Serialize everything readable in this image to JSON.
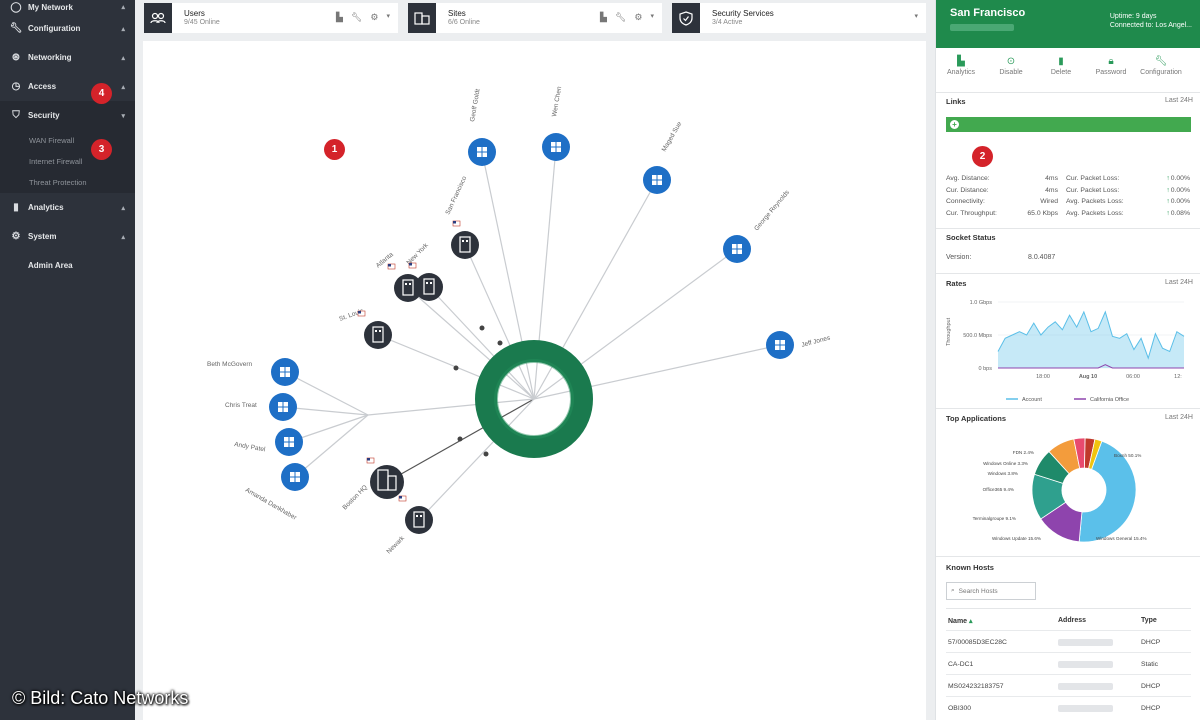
{
  "sidebar": {
    "items": [
      {
        "label": "My Network",
        "icon": "circle-icon"
      },
      {
        "label": "Configuration",
        "icon": "wrench-icon"
      },
      {
        "label": "Networking",
        "icon": "network-icon"
      },
      {
        "label": "Access",
        "icon": "clock-icon"
      },
      {
        "label": "Security",
        "icon": "shield-icon"
      }
    ],
    "security_sub": [
      "WAN Firewall",
      "Internet Firewall",
      "Threat Protection"
    ],
    "items2": [
      {
        "label": "Analytics",
        "icon": "bar-chart-icon"
      },
      {
        "label": "System",
        "icon": "gear-icon"
      }
    ],
    "admin": "Admin Area"
  },
  "badges": {
    "b1": "1",
    "b2": "2",
    "b3": "3",
    "b4": "4"
  },
  "topcards": [
    {
      "title": "Users",
      "sub": "9/45 Online",
      "icon": "users-icon"
    },
    {
      "title": "Sites",
      "sub": "6/6 Online",
      "icon": "buildings-icon"
    },
    {
      "title": "Security Services",
      "sub": "3/4 Active",
      "icon": "shield-icon"
    }
  ],
  "topology": {
    "hub": "san-francisco-hub",
    "nodes": [
      {
        "label": "Geoff Goldt",
        "kind": "windows"
      },
      {
        "label": "Wen Chen",
        "kind": "windows"
      },
      {
        "label": "Maged Sue",
        "kind": "windows"
      },
      {
        "label": "George Reynolds",
        "kind": "windows"
      },
      {
        "label": "Jeff Jones",
        "kind": "windows"
      },
      {
        "label": "San Francisco",
        "kind": "site"
      },
      {
        "label": "New York",
        "kind": "site"
      },
      {
        "label": "Atlanta",
        "kind": "site"
      },
      {
        "label": "St. Louis",
        "kind": "site"
      },
      {
        "label": "Beth McGovern",
        "kind": "windows"
      },
      {
        "label": "Chris Treat",
        "kind": "windows"
      },
      {
        "label": "Andy Patel",
        "kind": "windows"
      },
      {
        "label": "Amanda Dankhaber",
        "kind": "windows"
      },
      {
        "label": "Boston HQ",
        "kind": "hq"
      },
      {
        "label": "Newark",
        "kind": "site"
      }
    ]
  },
  "panel": {
    "title": "San Francisco",
    "uptime": "Uptime: 9 days",
    "connected": "Connected to: Los Angel...",
    "actions": [
      {
        "label": "Analytics",
        "icon": "analytics-icon"
      },
      {
        "label": "Disable",
        "icon": "disable-icon"
      },
      {
        "label": "Delete",
        "icon": "trash-icon"
      },
      {
        "label": "Password",
        "icon": "lock-icon"
      },
      {
        "label": "Configuration",
        "icon": "wrench-icon"
      }
    ],
    "links": {
      "title": "Links",
      "range": "Last 24H"
    },
    "metrics_left": [
      {
        "label": "Avg. Distance:",
        "value": "4ms"
      },
      {
        "label": "Cur. Distance:",
        "value": "4ms"
      },
      {
        "label": "Connectivity:",
        "value": "Wired"
      },
      {
        "label": "Cur. Throughput:",
        "value": "65.0 Kbps"
      }
    ],
    "metrics_right": [
      {
        "label": "Cur. Packet Loss:",
        "value": "0.00%"
      },
      {
        "label": "Cur. Packet Loss:",
        "value": "0.00%"
      },
      {
        "label": "Avg. Packets Loss:",
        "value": "0.00%"
      },
      {
        "label": "Avg. Packets Loss:",
        "value": "0.08%"
      }
    ],
    "socket": {
      "title": "Socket Status",
      "version_label": "Version:",
      "version": "8.0.4087"
    },
    "rates": {
      "title": "Rates",
      "range": "Last 24H"
    },
    "top_apps": {
      "title": "Top Applications",
      "range": "Last 24H"
    },
    "hosts": {
      "title": "Known Hosts",
      "search_placeholder": "Search Hosts",
      "columns": [
        "Name",
        "Address",
        "Type"
      ],
      "rows": [
        {
          "name": "57/00085D3EC28C",
          "type": "DHCP"
        },
        {
          "name": "CA-DC1",
          "type": "Static"
        },
        {
          "name": "MS024232183757",
          "type": "DHCP"
        },
        {
          "name": "OBI300",
          "type": "DHCP"
        }
      ]
    }
  },
  "chart_data": [
    {
      "type": "area",
      "title": "Rates",
      "ylabel": "Throughput",
      "yticks": [
        "1.0 Gbps",
        "500.0 Mbps",
        "0 bps"
      ],
      "xticks": [
        "18:00",
        "Aug 10",
        "06:00",
        "12:"
      ],
      "series": [
        {
          "name": "Account",
          "color": "#5bbfe8",
          "values": [
            0.25,
            0.45,
            0.5,
            0.55,
            0.5,
            0.68,
            0.5,
            0.62,
            0.7,
            0.58,
            0.8,
            0.62,
            0.85,
            0.55,
            0.6,
            0.85,
            0.48,
            0.45,
            0.52,
            0.28,
            0.45,
            0.15,
            0.52,
            0.3,
            0.25,
            0.55,
            0.48
          ]
        },
        {
          "name": "California Office",
          "color": "#8e44ad",
          "values": [
            0.0,
            0.0,
            0.0,
            0.0,
            0.0,
            0.0,
            0.0,
            0.0,
            0.0,
            0.0,
            0.0,
            0.0,
            0.0,
            0.0,
            0.0,
            0.05,
            0.0,
            0.0,
            0.0,
            0.0,
            0.0,
            0.0,
            0.0,
            0.0,
            0.0,
            0.0,
            0.0
          ]
        }
      ]
    },
    {
      "type": "pie",
      "title": "Top Applications",
      "labels": [
        "Boxnh 50.1%",
        "Windows General 15.4%",
        "Windows Update 15.6%",
        "Terminalgroupe 9.1%",
        "Office365 9.4%",
        "Windows 3.8%",
        "Windows Online 3.3%",
        "FDN 2.4%"
      ],
      "values": [
        50.1,
        15.4,
        15.6,
        9.1,
        9.4,
        3.8,
        3.3,
        2.4
      ],
      "colors": [
        "#5bc0ea",
        "#8e44ad",
        "#2fa08e",
        "#1f8a6a",
        "#f39c3c",
        "#e84a6e",
        "#c0392b",
        "#f1c40f"
      ]
    }
  ]
}
